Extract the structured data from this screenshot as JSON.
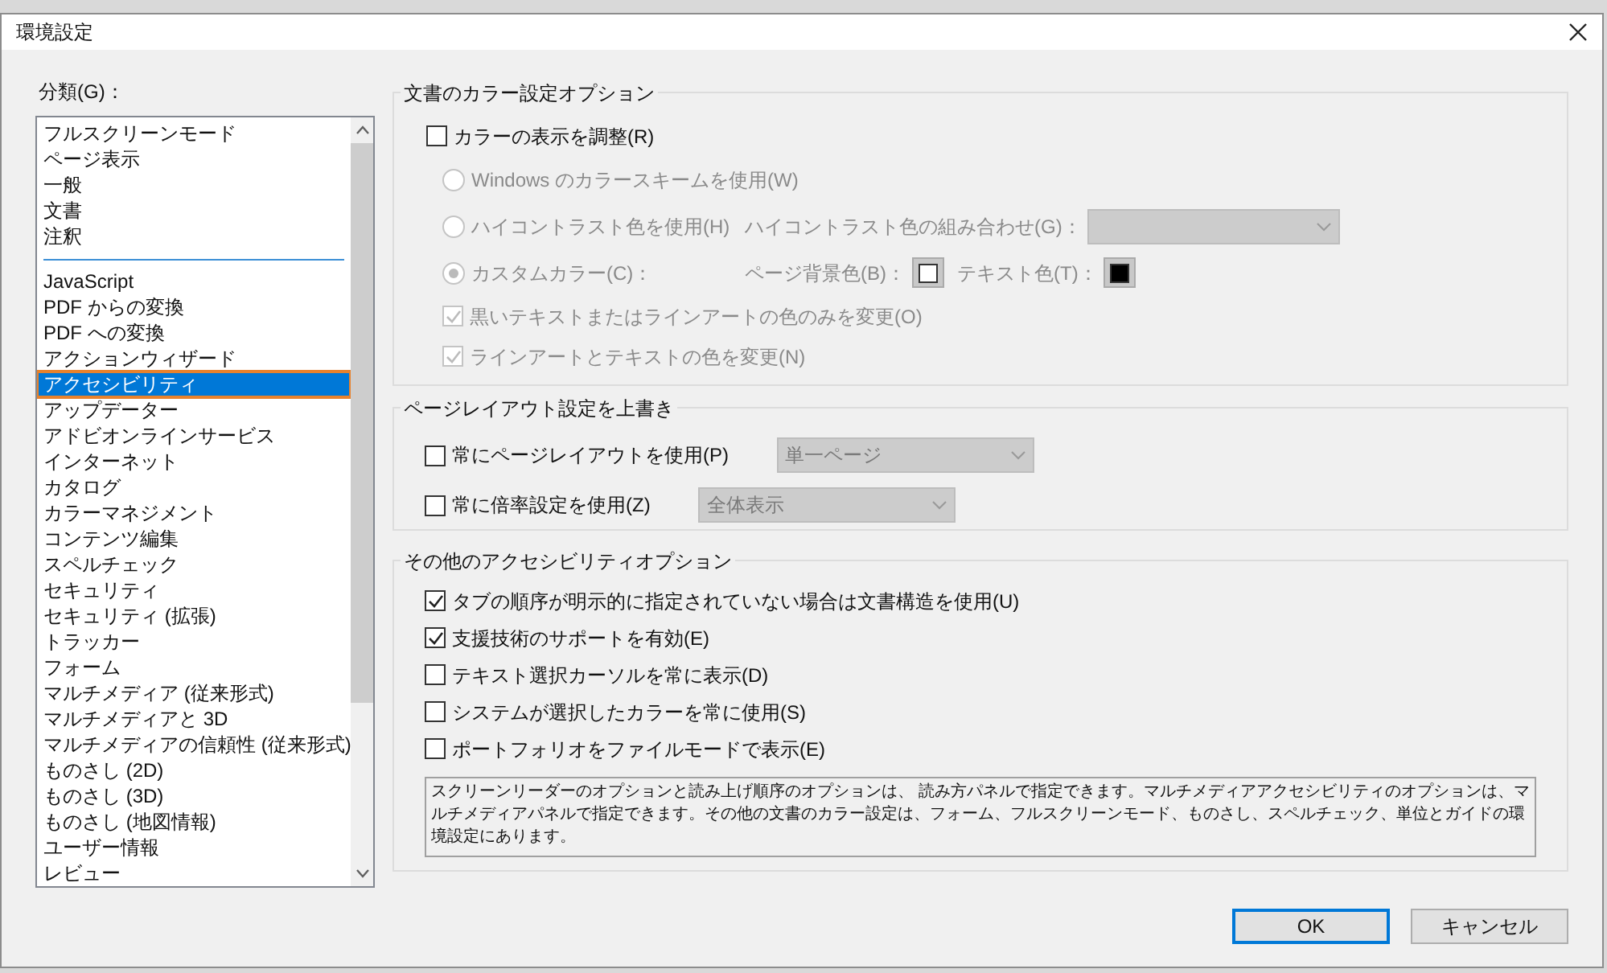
{
  "window": {
    "title": "環境設定"
  },
  "category": {
    "label": "分類(G)：",
    "items": [
      {
        "kind": "item",
        "label": "フルスクリーンモード",
        "selected": false
      },
      {
        "kind": "item",
        "label": "ページ表示",
        "selected": false
      },
      {
        "kind": "item",
        "label": "一般",
        "selected": false
      },
      {
        "kind": "item",
        "label": "文書",
        "selected": false
      },
      {
        "kind": "item",
        "label": "注釈",
        "selected": false
      },
      {
        "kind": "separator"
      },
      {
        "kind": "item",
        "label": "JavaScript",
        "selected": false
      },
      {
        "kind": "item",
        "label": "PDF からの変換",
        "selected": false
      },
      {
        "kind": "item",
        "label": "PDF への変換",
        "selected": false
      },
      {
        "kind": "item",
        "label": "アクションウィザード",
        "selected": false
      },
      {
        "kind": "item",
        "label": "アクセシビリティ",
        "selected": true
      },
      {
        "kind": "item",
        "label": "アップデーター",
        "selected": false
      },
      {
        "kind": "item",
        "label": "アドビオンラインサービス",
        "selected": false
      },
      {
        "kind": "item",
        "label": "インターネット",
        "selected": false
      },
      {
        "kind": "item",
        "label": "カタログ",
        "selected": false
      },
      {
        "kind": "item",
        "label": "カラーマネジメント",
        "selected": false
      },
      {
        "kind": "item",
        "label": "コンテンツ編集",
        "selected": false
      },
      {
        "kind": "item",
        "label": "スペルチェック",
        "selected": false
      },
      {
        "kind": "item",
        "label": "セキュリティ",
        "selected": false
      },
      {
        "kind": "item",
        "label": "セキュリティ (拡張)",
        "selected": false
      },
      {
        "kind": "item",
        "label": "トラッカー",
        "selected": false
      },
      {
        "kind": "item",
        "label": "フォーム",
        "selected": false
      },
      {
        "kind": "item",
        "label": "マルチメディア (従来形式)",
        "selected": false
      },
      {
        "kind": "item",
        "label": "マルチメディアと 3D",
        "selected": false
      },
      {
        "kind": "item",
        "label": "マルチメディアの信頼性 (従来形式)",
        "selected": false
      },
      {
        "kind": "item",
        "label": "ものさし (2D)",
        "selected": false
      },
      {
        "kind": "item",
        "label": "ものさし (3D)",
        "selected": false
      },
      {
        "kind": "item",
        "label": "ものさし (地図情報)",
        "selected": false
      },
      {
        "kind": "item",
        "label": "ユーザー情報",
        "selected": false
      },
      {
        "kind": "item",
        "label": "レビュー",
        "selected": false
      }
    ]
  },
  "color_options": {
    "title": "文書のカラー設定オプション",
    "rows": [
      {
        "kind": "checkbox",
        "label": "カラーの表示を調整(R)",
        "checked": false,
        "disabled": false,
        "children": [
          {
            "kind": "radio",
            "label": "Windows のカラースキームを使用(W)",
            "selected": false,
            "disabled": true
          },
          {
            "kind": "radio",
            "label": "ハイコントラスト色を使用(H)",
            "selected": false,
            "disabled": true,
            "combo_label": "ハイコントラスト色の組み合わせ(G)："
          },
          {
            "kind": "radio",
            "label": "カスタムカラー(C)：",
            "selected": true,
            "disabled": true,
            "swatches": [
              {
                "label": "ページ背景色(B)：",
                "color": "#ffffff"
              },
              {
                "label": "テキスト色(T)：",
                "color": "#000000"
              }
            ]
          },
          {
            "kind": "checkbox",
            "label": "黒いテキストまたはラインアートの色のみを変更(O)",
            "checked": true,
            "disabled": true
          },
          {
            "kind": "checkbox",
            "label": "ラインアートとテキストの色を変更(N)",
            "checked": true,
            "disabled": true
          }
        ]
      }
    ]
  },
  "page_layout": {
    "title": "ページレイアウト設定を上書き",
    "rows": [
      {
        "label": "常にページレイアウトを使用(P)",
        "checked": false,
        "dropdown": {
          "value": "単一ページ",
          "disabled": true
        }
      },
      {
        "label": "常に倍率設定を使用(Z)",
        "checked": false,
        "dropdown": {
          "value": "全体表示",
          "disabled": true
        }
      }
    ]
  },
  "other_options": {
    "title": "その他のアクセシビリティオプション",
    "rows": [
      {
        "label": "タブの順序が明示的に指定されていない場合は文書構造を使用(U)",
        "checked": true
      },
      {
        "label": "支援技術のサポートを有効(E)",
        "checked": true
      },
      {
        "label": "テキスト選択カーソルを常に表示(D)",
        "checked": false
      },
      {
        "label": "システムが選択したカラーを常に使用(S)",
        "checked": false
      },
      {
        "label": "ポートフォリオをファイルモードで表示(E)",
        "checked": false
      }
    ],
    "note": "スクリーンリーダーのオプションと読み上げ順序のオプションは、 読み方パネルで指定できます。マルチメディアアクセシビリティのオプションは、マルチメディアパネルで指定できます。その他の文書のカラー設定は、フォーム、フルスクリーンモード、ものさし、スペルチェック、単位とガイドの環境設定にあります。"
  },
  "buttons": [
    {
      "kind": "primary",
      "label": "OK"
    },
    {
      "kind": "secondary",
      "label": "キャンセル"
    }
  ]
}
